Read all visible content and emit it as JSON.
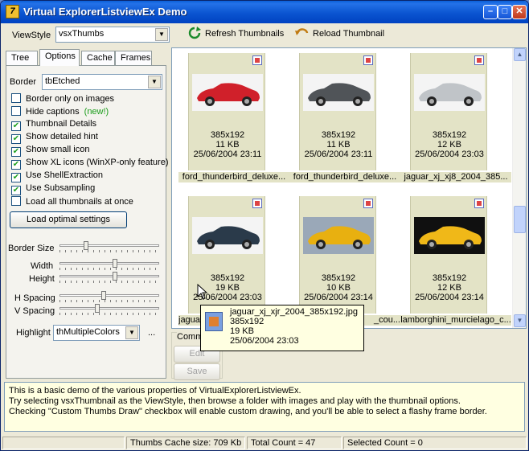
{
  "window": {
    "title": "Virtual ExplorerListviewEx Demo",
    "controls": [
      "minimize",
      "maximize",
      "close"
    ]
  },
  "viewstyle": {
    "label": "ViewStyle",
    "value": "vsxThumbs"
  },
  "toolbar": {
    "refresh_label": "Refresh Thumbnails",
    "reload_label": "Reload Thumbnail"
  },
  "tabs": [
    "Tree",
    "Options",
    "Cache",
    "Frames"
  ],
  "active_tab": "Options",
  "options": {
    "border_label": "Border",
    "border_value": "tbEtched",
    "checks": [
      {
        "label": "Border only on images",
        "checked": false
      },
      {
        "label": "Hide captions",
        "checked": false,
        "note": "(new!)"
      },
      {
        "label": "Thumbnail Details",
        "checked": true
      },
      {
        "label": "Show detailed hint",
        "checked": true
      },
      {
        "label": "Show small icon",
        "checked": true
      },
      {
        "label": "Show XL icons (WinXP-only feature)",
        "checked": true
      },
      {
        "label": "Use ShellExtraction",
        "checked": true
      },
      {
        "label": "Use Subsampling",
        "checked": true
      },
      {
        "label": "Load all thumbnails at once",
        "checked": false
      }
    ],
    "load_optimal_label": "Load optimal settings",
    "border_size_label": "Border Size",
    "width_label": "Width",
    "height_label": "Height",
    "hspacing_label": "H Spacing",
    "vspacing_label": "V Spacing",
    "highlight_label": "Highlight",
    "highlight_value": "thMultipleColors",
    "ellipsis_label": "..."
  },
  "thumbnails": [
    {
      "dims": "385x192",
      "size": "11 KB",
      "date": "25/06/2004 23:11",
      "caption": "ford_thunderbird_deluxe...",
      "car_color": "#d0202a"
    },
    {
      "dims": "385x192",
      "size": "11 KB",
      "date": "25/06/2004 23:11",
      "caption": "ford_thunderbird_deluxe...",
      "car_color": "#505458"
    },
    {
      "dims": "385x192",
      "size": "12 KB",
      "date": "25/06/2004 23:03",
      "caption": "jaguar_xj_xj8_2004_385...",
      "car_color": "#c0c4c8"
    },
    {
      "dims": "385x192",
      "size": "19 KB",
      "date": "25/06/2004 23:03",
      "caption": "jagua",
      "car_color": "#2a3a4a"
    },
    {
      "dims": "385x192",
      "size": "10 KB",
      "date": "25/06/2004 23:14",
      "caption": "_cou...",
      "car_color": "#e8b010"
    },
    {
      "dims": "385x192",
      "size": "12 KB",
      "date": "25/06/2004 23:14",
      "caption": "lamborghini_murcielago_c...",
      "car_color": "#f0b818"
    }
  ],
  "tooltip": {
    "filename": "jaguar_xj_xjr_2004_385x192.jpg",
    "dims": "385x192",
    "size": "19 KB",
    "date": "25/06/2004 23:03"
  },
  "comment_group": {
    "label": "Comm",
    "edit_label": "Edit",
    "save_label": "Save"
  },
  "description": [
    "This is a basic demo of the various properties of VirtualExplorerListviewEx.",
    "Try selecting vsxThumbnail as the ViewStyle, then browse a folder with images and play with the thumbnail options.",
    "Checking \"Custom Thumbs Draw\" checkbox will enable custom drawing, and you'll be able to select a flashy frame border."
  ],
  "status": {
    "cache": "Thumbs Cache size: 709 Kb",
    "total": "Total Count = 47",
    "selected": "Selected Count = 0"
  },
  "colors": {
    "title_bar": "#0b55d1",
    "thumb_frame": "#e3e3c6",
    "tooltip_bg": "#ffffe1"
  }
}
